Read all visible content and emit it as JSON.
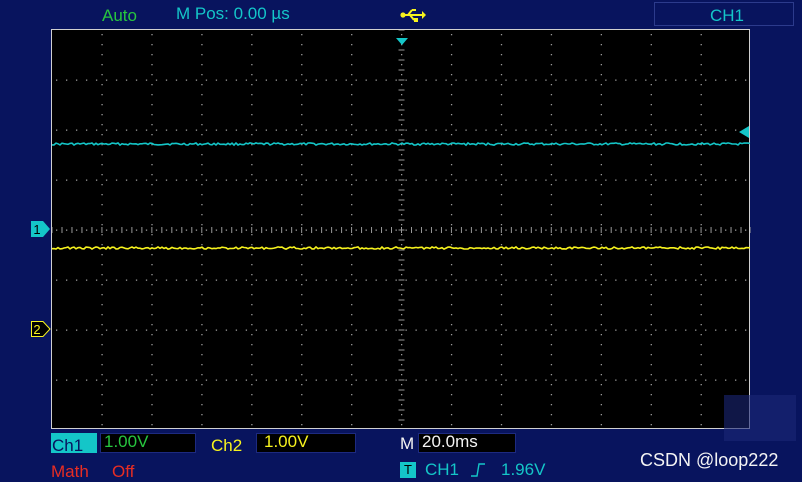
{
  "header": {
    "mode": "Auto",
    "horizontal_position": "M Pos: 0.00 µs",
    "usb_icon": "usb-icon",
    "active_channel": "CH1"
  },
  "channels": {
    "ch1": {
      "label": "Ch1",
      "scale": "1.00V",
      "marker": "1",
      "color": "#14c6c8"
    },
    "ch2": {
      "label": "Ch2",
      "scale": "1.00V",
      "marker": "2",
      "color": "#f7f31e"
    }
  },
  "math": {
    "label": "Math",
    "state": "Off"
  },
  "timebase": {
    "prefix": "M",
    "value": "20.0ms"
  },
  "trigger": {
    "badge": "T",
    "source": "CH1",
    "slope_icon": "rising-edge-icon",
    "level": "1.96V"
  },
  "watermark": "CSDN @loop222",
  "colors": {
    "background": "#08145e",
    "screen": "#000000",
    "green": "#27c63f",
    "red": "#e82d23"
  }
}
